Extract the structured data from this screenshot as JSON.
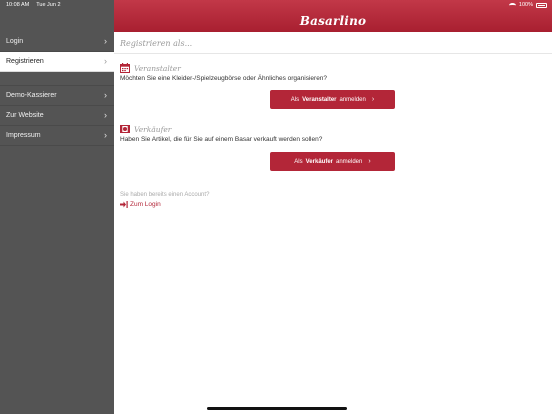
{
  "status": {
    "time": "10:08 AM",
    "date": "Tue Jun 2",
    "battery": "100%"
  },
  "app": {
    "logo": "Basarlino"
  },
  "sidebar": {
    "items": [
      {
        "label": "Login"
      },
      {
        "label": "Registrieren"
      },
      {
        "label": "Demo-Kassierer"
      },
      {
        "label": "Zur Website"
      },
      {
        "label": "Impressum"
      }
    ]
  },
  "main": {
    "title": "Registrieren als...",
    "organizer": {
      "title": "Veranstalter",
      "text": "Möchten Sie eine Kleider-/Spielzeugbörse oder Ähnliches organisieren?",
      "button_pre": "Als",
      "button_strong": "Veranstalter",
      "button_post": "anmelden"
    },
    "seller": {
      "title": "Verkäufer",
      "text": "Haben Sie Artikel, die für Sie auf einem Basar verkauft werden sollen?",
      "button_pre": "Als",
      "button_strong": "Verkäufer",
      "button_post": "anmelden"
    },
    "account": {
      "question": "Sie haben bereits einen Account?",
      "link": "Zum Login"
    }
  },
  "colors": {
    "brand": "#b32638",
    "sidebar": "#545454"
  }
}
